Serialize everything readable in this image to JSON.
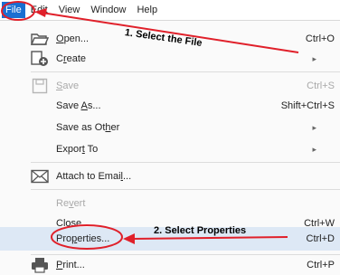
{
  "menubar": {
    "items": [
      {
        "label": "File"
      },
      {
        "label": "Edit"
      },
      {
        "label": "View"
      },
      {
        "label": "Window"
      },
      {
        "label": "Help"
      }
    ]
  },
  "menu": {
    "open": {
      "pre": "",
      "u": "O",
      "post": "pen...",
      "shortcut": "Ctrl+O"
    },
    "create": {
      "pre": "C",
      "u": "r",
      "post": "eate",
      "submenu": "▸"
    },
    "save": {
      "pre": "",
      "u": "S",
      "post": "ave",
      "shortcut": "Ctrl+S"
    },
    "save_as": {
      "pre": "Save ",
      "u": "A",
      "post": "s...",
      "shortcut": "Shift+Ctrl+S"
    },
    "save_other": {
      "pre": "Save as Ot",
      "u": "h",
      "post": "er",
      "submenu": "▸"
    },
    "export_to": {
      "pre": "Expor",
      "u": "t",
      "post": " To",
      "submenu": "▸"
    },
    "attach": {
      "pre": "Attach to Emai",
      "u": "l",
      "post": "..."
    },
    "revert": {
      "pre": "Re",
      "u": "v",
      "post": "ert"
    },
    "close": {
      "pre": "",
      "u": "C",
      "post": "lose",
      "shortcut": "Ctrl+W"
    },
    "properties": {
      "pre": "Pro",
      "u": "p",
      "post": "erties...",
      "shortcut": "Ctrl+D"
    },
    "print": {
      "pre": "",
      "u": "P",
      "post": "rint...",
      "shortcut": "Ctrl+P"
    }
  },
  "annotations": {
    "step1": "1. Select the File",
    "step2": "2. Select Properties",
    "color": "#e0202a"
  },
  "colors": {
    "accent": "#1a6fd1",
    "highlight": "#dde8f5",
    "disabled": "#a9a9a9"
  }
}
